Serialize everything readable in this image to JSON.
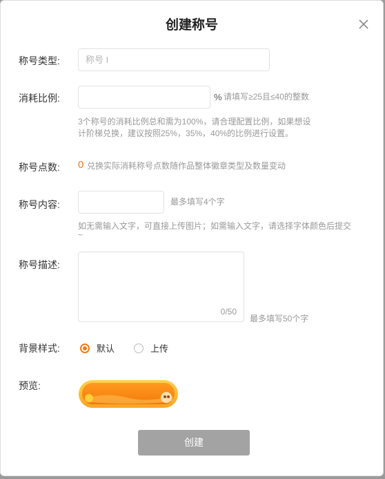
{
  "dialog": {
    "title": "创建称号",
    "close_icon": "close-icon"
  },
  "form": {
    "type": {
      "label": "称号类型:",
      "placeholder": "称号 I"
    },
    "ratio": {
      "label": "消耗比例:",
      "unit": "%",
      "rule": "请填写≥25且≤40的整数",
      "hint_line1": "3个称号的消耗比例总和需为100%，请合理配置比例，如果想设",
      "hint_line2": "计阶梯兑换，建议按照25%，35%，40%的比例进行设置。"
    },
    "points": {
      "label": "称号点数:",
      "value": "0",
      "desc": "兑换实际消耗称号点数随作品整体徽章类型及数量变动"
    },
    "content": {
      "label": "称号内容:",
      "limit": "最多填写4个字",
      "hint_line1": "如无需输入文字，可直接上传图片；如需输入文字，请选择字体颜色后提交",
      "hint_line2": "~"
    },
    "desc": {
      "label": "称号描述:",
      "counter": "0/50",
      "limit": "最多填写50个字"
    },
    "background": {
      "label": "背景样式:",
      "options": [
        "默认",
        "上传"
      ],
      "selected": "默认"
    },
    "preview": {
      "label": "预览:"
    }
  },
  "submit_label": "创建",
  "colors": {
    "accent": "#f07a18",
    "disabled_button": "#a3a3a3"
  }
}
